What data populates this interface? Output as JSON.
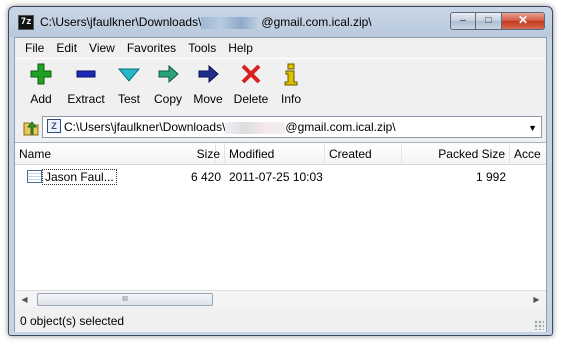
{
  "window": {
    "app_icon_text": "7z",
    "title_prefix": "C:\\Users\\jfaulkner\\Downloads\\",
    "title_suffix": "@gmail.com.ical.zip\\",
    "min_glyph": "–",
    "max_glyph": "□",
    "close_glyph": "✕"
  },
  "menu": [
    "File",
    "Edit",
    "View",
    "Favorites",
    "Tools",
    "Help"
  ],
  "toolbar": {
    "add": "Add",
    "extract": "Extract",
    "test": "Test",
    "copy": "Copy",
    "move": "Move",
    "delete": "Delete",
    "info": "Info"
  },
  "address": {
    "icon_text": "Z",
    "prefix": "C:\\Users\\jfaulkner\\Downloads\\",
    "suffix": "@gmail.com.ical.zip\\",
    "dropdown_glyph": "▼"
  },
  "columns": {
    "name": "Name",
    "size": "Size",
    "modified": "Modified",
    "created": "Created",
    "packed_size": "Packed Size",
    "accessed": "Acce"
  },
  "rows": [
    {
      "name": "Jason Faul...",
      "size": "6 420",
      "modified": "2011-07-25 10:03",
      "created": "",
      "packed_size": "1 992"
    }
  ],
  "scrollbar": {
    "left_glyph": "◀",
    "right_glyph": "▶",
    "thumb_grip": "III"
  },
  "status": {
    "text": "0 object(s) selected"
  },
  "colors": {
    "add": "#21a121",
    "extract": "#1b2bb8",
    "test": "#26b8c8",
    "copy": "#2aa37a",
    "move": "#1f2d8c",
    "delete": "#d91f1f",
    "info": "#e0c000"
  }
}
